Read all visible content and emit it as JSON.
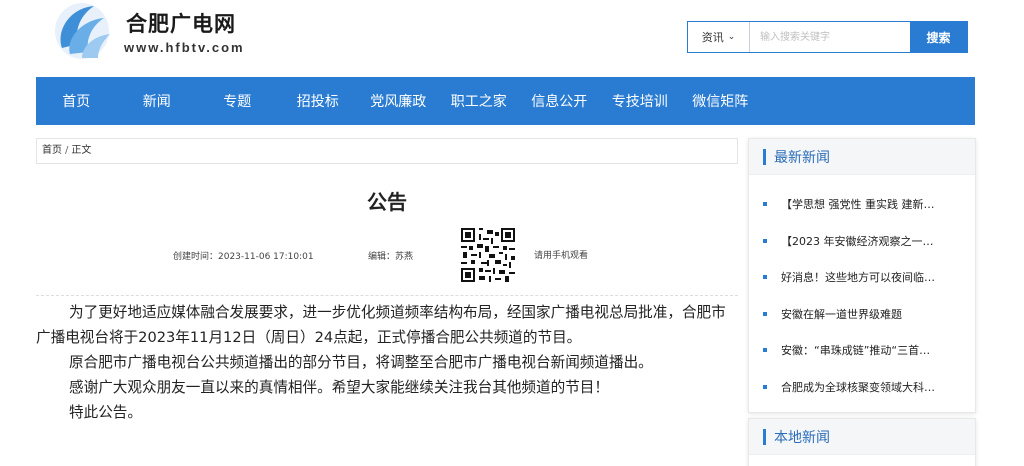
{
  "header": {
    "site_name": "合肥广电网",
    "site_url": "www.hfbtv.com",
    "colors": {
      "brand_blue": "#2a7cd3",
      "logo_blue": "#3f8fd8"
    }
  },
  "search": {
    "category": "资讯",
    "placeholder": "输入搜索关键字",
    "button_label": "搜索"
  },
  "nav": {
    "items": [
      "首页",
      "新闻",
      "专题",
      "招投标",
      "党风廉政",
      "职工之家",
      "信息公开",
      "专技培训",
      "微信矩阵"
    ]
  },
  "breadcrumb": {
    "home": "首页",
    "separator": "/",
    "current": "正文"
  },
  "article": {
    "title": "公告",
    "created": "创建时间：2023-11-06 17:10:01",
    "editor": "编辑：苏燕",
    "mobile_tip": "请用手机观看",
    "paragraphs": [
      "为了更好地适应媒体融合发展要求，进一步优化频道频率结构布局，经国家广播电视总局批准，合肥市广播电视台将于2023年11月12日（周日）24点起，正式停播合肥公共频道的节目。",
      "原合肥市广播电视台公共频道播出的部分节目，将调整至合肥市广播电视台新闻频道播出。",
      "感谢广大观众朋友一直以来的真情相伴。希望大家能继续关注我台其他频道的节目！",
      "特此公告。"
    ]
  },
  "sidebar": {
    "latest_title": "最新新闻",
    "latest_items": [
      "【学思想 强党性 重实践 建新…",
      "【2023 年安徽经济观察之一…",
      "好消息！这些地方可以夜间临…",
      "安徽在解一道世界级难题",
      "安徽：“串珠成链”推动“三首…",
      "合肥成为全球核聚变领域大科…"
    ],
    "local_title": "本地新闻"
  }
}
